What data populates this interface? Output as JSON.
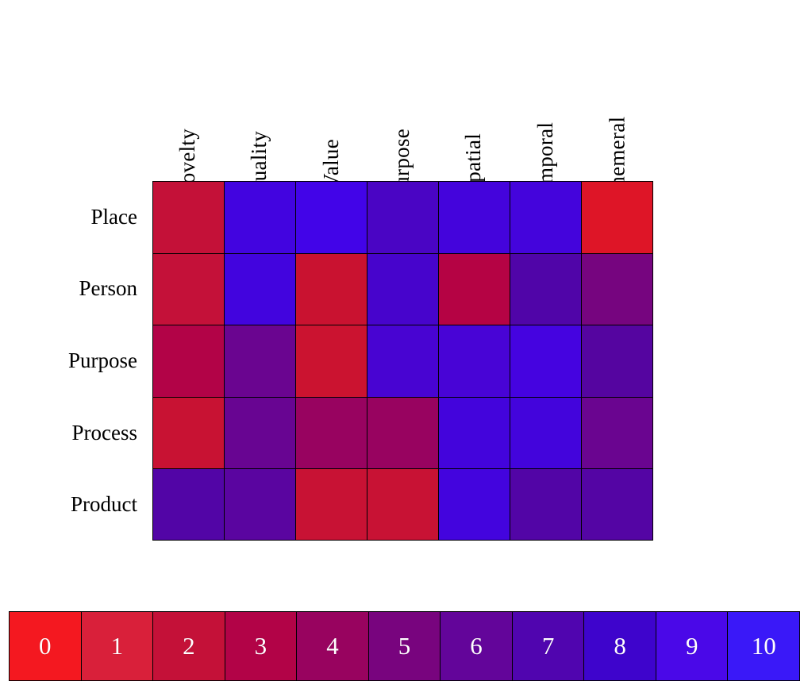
{
  "chart_data": {
    "type": "heatmap",
    "title": "",
    "xlabel": "",
    "ylabel": "",
    "grid": true,
    "legend_position": "bottom",
    "columns": [
      "Novelty",
      "Quality",
      "Value",
      "Purpose",
      "Spatial",
      "Temporal",
      "Ephemeral"
    ],
    "rows": [
      "Place",
      "Person",
      "Purpose",
      "Process",
      "Product"
    ],
    "zlim": [
      0,
      10
    ],
    "values": [
      [
        2,
        9,
        9,
        8,
        9,
        9,
        1
      ],
      [
        2,
        9,
        2,
        8,
        3,
        7,
        5
      ],
      [
        3,
        6,
        2,
        8,
        8,
        10,
        7
      ],
      [
        2,
        6,
        4,
        4,
        9,
        9,
        6
      ],
      [
        7,
        7,
        2,
        2,
        9,
        7,
        7
      ]
    ],
    "cell_colors": [
      [
        "#C41138",
        "#4204E0",
        "#4204E8",
        "#4A05C4",
        "#4404DC",
        "#4404DC",
        "#DE1527"
      ],
      [
        "#C41139",
        "#4204DE",
        "#C91230",
        "#4704CC",
        "#B50344",
        "#5005A8",
        "#76057F"
      ],
      [
        "#B20347",
        "#6A0590",
        "#CB1330",
        "#4804D2",
        "#4804D6",
        "#4503E0",
        "#5505A0"
      ],
      [
        "#C81233",
        "#680592",
        "#980360",
        "#980360",
        "#4304DC",
        "#4304DC",
        "#6A0590"
      ],
      [
        "#5205A6",
        "#5A05A0",
        "#C81234",
        "#C81234",
        "#4304DE",
        "#5205A6",
        "#5405A4"
      ]
    ],
    "colorbar": {
      "ticks": [
        "0",
        "1",
        "2",
        "3",
        "4",
        "5",
        "6",
        "7",
        "8",
        "9",
        "10"
      ],
      "colors": [
        "#F41820",
        "#D9203A",
        "#C41138",
        "#B20347",
        "#98035F",
        "#78047E",
        "#63059A",
        "#5005AF",
        "#3E04CC",
        "#4A08E8",
        "#3A18F8"
      ]
    },
    "border_color": "#000000",
    "background": "#ffffff",
    "tick_label_color": "#ffffff"
  }
}
